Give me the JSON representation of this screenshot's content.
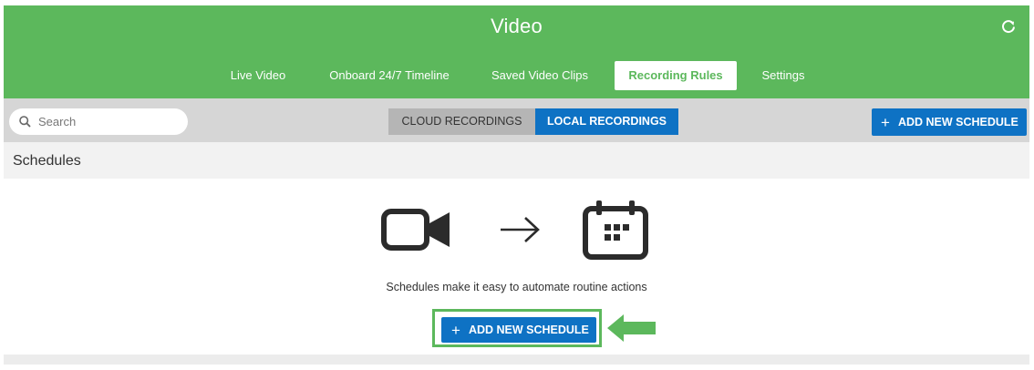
{
  "header": {
    "title": "Video",
    "refresh_icon": "refresh-icon"
  },
  "tabs": [
    {
      "label": "Live Video",
      "active": false
    },
    {
      "label": "Onboard 24/7 Timeline",
      "active": false
    },
    {
      "label": "Saved Video Clips",
      "active": false
    },
    {
      "label": "Recording Rules",
      "active": true
    },
    {
      "label": "Settings",
      "active": false
    }
  ],
  "toolbar": {
    "search_placeholder": "Search",
    "segments": {
      "cloud": "CLOUD RECORDINGS",
      "local": "LOCAL RECORDINGS",
      "selected": "local"
    },
    "add_label": "ADD NEW SCHEDULE"
  },
  "schedules": {
    "title": "Schedules",
    "empty_message": "Schedules make it easy to automate routine actions",
    "add_label": "ADD NEW SCHEDULE",
    "icons": [
      "video-camera-icon",
      "arrow-right-icon",
      "calendar-icon"
    ]
  },
  "colors": {
    "brand_green": "#5cb85c",
    "primary_blue": "#0e72c4",
    "toolbar_gray": "#d6d6d6"
  }
}
